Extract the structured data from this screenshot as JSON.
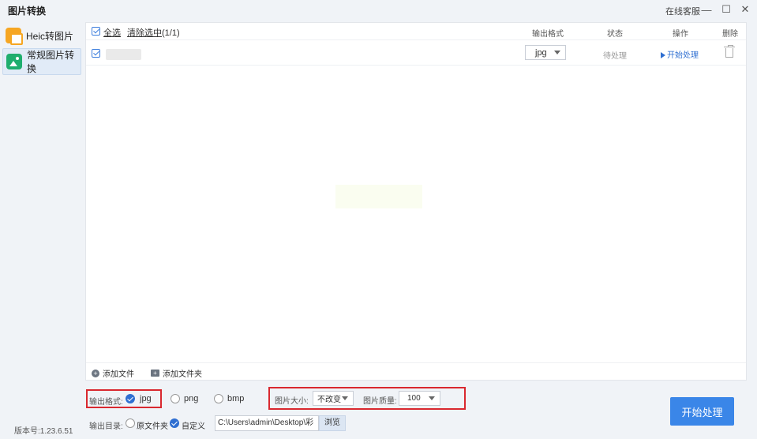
{
  "window": {
    "title": "图片转换",
    "support_link": "在线客服",
    "minimize_glyph": "—",
    "maximize_glyph": "☐",
    "close_glyph": "✕"
  },
  "sidebar": {
    "items": [
      {
        "label": "Heic转图片",
        "icon": "heic-image-icon",
        "active": false
      },
      {
        "label": "常规图片转换",
        "icon": "image-convert-icon",
        "active": true
      }
    ],
    "version": "版本号:1.23.6.51"
  },
  "list": {
    "select_all": "全选",
    "clear_selection_label": "清除选中",
    "clear_selection_count": "(1/1)",
    "columns": {
      "format": "输出格式",
      "status": "状态",
      "action": "操作",
      "delete": "删除"
    },
    "rows": [
      {
        "checked": true,
        "format": "jpg",
        "status": "待处理",
        "action": "开始处理"
      }
    ]
  },
  "footer": {
    "add_file": "添加文件",
    "add_folder": "添加文件夹"
  },
  "settings": {
    "output_format_label": "输出格式:",
    "formats": [
      {
        "label": "jpg",
        "selected": true
      },
      {
        "label": "png",
        "selected": false
      },
      {
        "label": "bmp",
        "selected": false
      }
    ],
    "image_size_label": "图片大小:",
    "image_size_value": "不改变",
    "image_quality_label": "图片质量:",
    "image_quality_value": "100",
    "output_dir_label": "输出目录:",
    "dir_options": [
      {
        "label": "原文件夹",
        "selected": false
      },
      {
        "label": "自定义",
        "selected": true
      }
    ],
    "output_path": "C:\\Users\\admin\\Desktop\\彩",
    "browse": "浏览",
    "start": "开始处理"
  },
  "colors": {
    "accent": "#3a86e8",
    "link": "#2f6fd1",
    "highlight_border": "#d9282f"
  }
}
